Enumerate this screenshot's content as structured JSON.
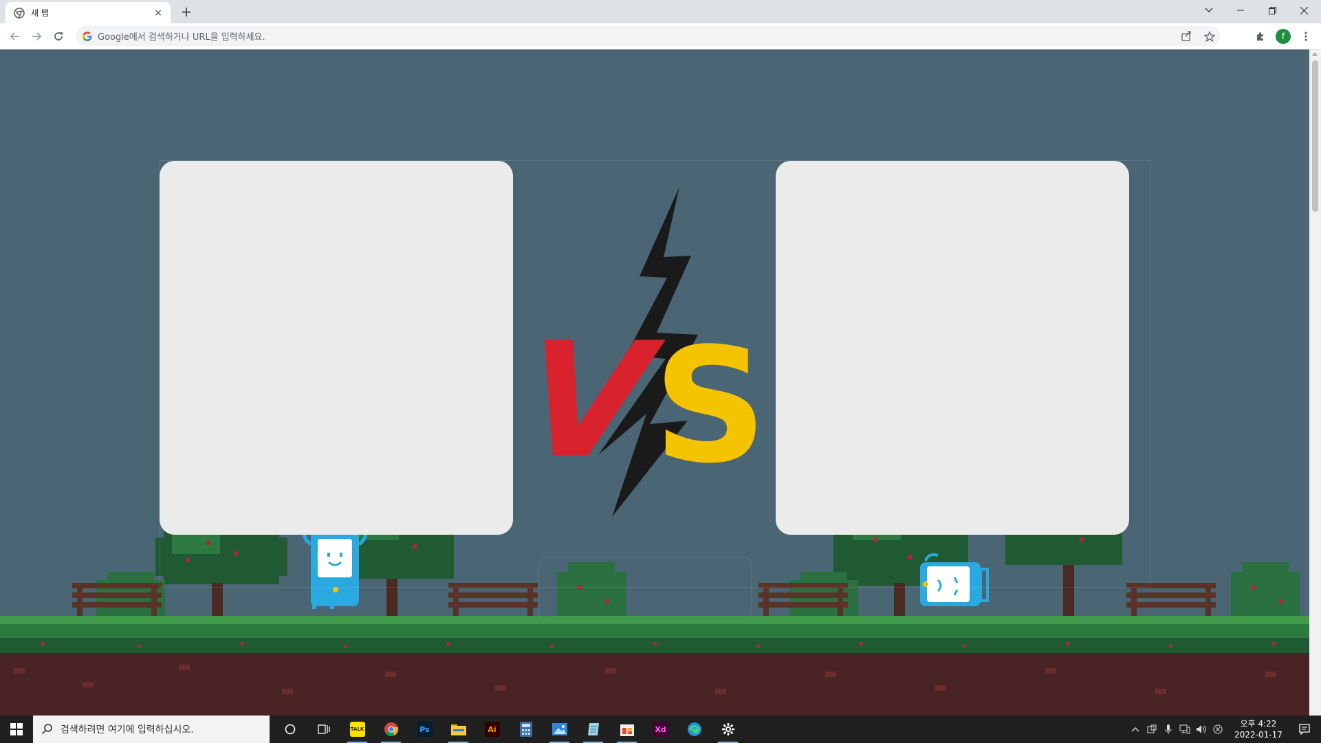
{
  "browser": {
    "tab_title": "새 탭",
    "tab_close": "×",
    "new_tab": "+",
    "omnibox_placeholder": "Google에서 검색하거나 URL을 입력하세요.",
    "profile_initial": "f"
  },
  "content": {
    "vs_text": [
      "V",
      "S"
    ],
    "colors": {
      "background": "#4a6675",
      "card": "#ebebeb",
      "v_red": "#d8222e",
      "s_yellow": "#f5c400",
      "bolt": "#1a1a1a"
    }
  },
  "taskbar": {
    "search_placeholder": "검색하려면 여기에 입력하십시오.",
    "apps": [
      {
        "name": "kakaotalk",
        "label": "TALK"
      },
      {
        "name": "chrome",
        "label": ""
      },
      {
        "name": "photoshop",
        "label": "Ps"
      },
      {
        "name": "file-explorer",
        "label": ""
      },
      {
        "name": "illustrator",
        "label": "Ai"
      },
      {
        "name": "calculator",
        "label": ""
      },
      {
        "name": "photos",
        "label": ""
      },
      {
        "name": "notepad",
        "label": ""
      },
      {
        "name": "store-app",
        "label": ""
      },
      {
        "name": "adobe-xd",
        "label": "Xd"
      },
      {
        "name": "edge",
        "label": ""
      },
      {
        "name": "settings",
        "label": ""
      }
    ],
    "clock_time": "오후 4:22",
    "clock_date": "2022-01-17"
  }
}
